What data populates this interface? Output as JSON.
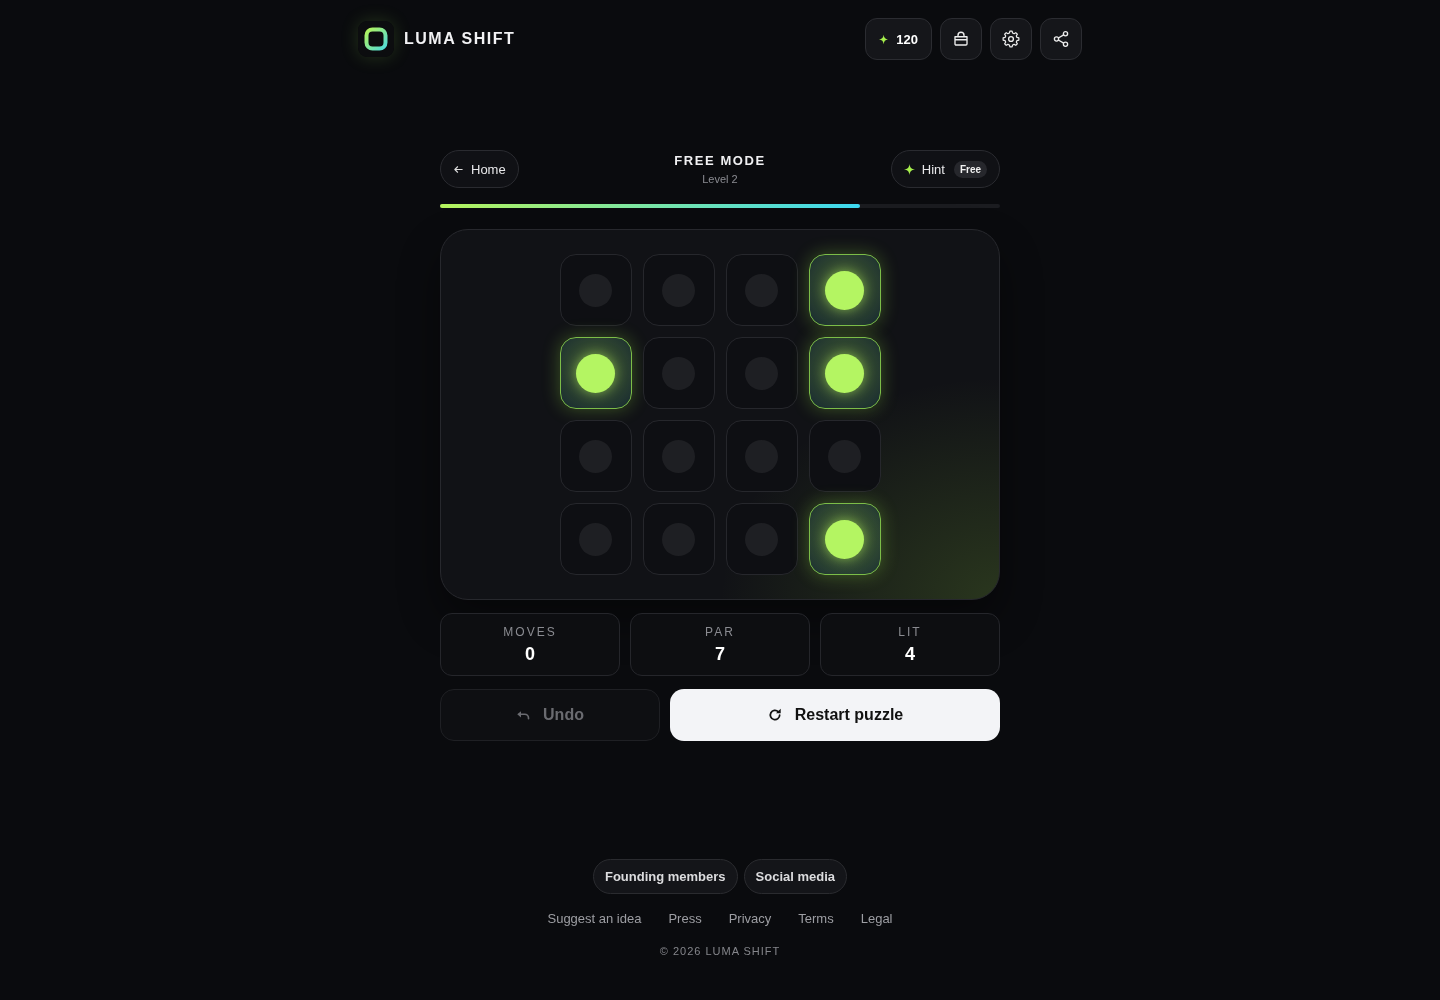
{
  "header": {
    "brand": "LUMA SHIFT",
    "coins": "120"
  },
  "game": {
    "back_button": "Home",
    "mode": "FREE MODE",
    "level": "Level 2",
    "hint": {
      "label": "Hint",
      "badge": "Free"
    },
    "progress": {
      "level": 0.75
    },
    "board": {
      "rows": [
        [
          {
            "lit": false
          },
          {
            "lit": false
          },
          {
            "lit": false
          },
          {
            "lit": true
          }
        ],
        [
          {
            "lit": true
          },
          {
            "lit": false
          },
          {
            "lit": false
          },
          {
            "lit": true
          }
        ],
        [
          {
            "lit": false
          },
          {
            "lit": false
          },
          {
            "lit": false
          },
          {
            "lit": false
          }
        ],
        [
          {
            "lit": false
          },
          {
            "lit": false
          },
          {
            "lit": false
          },
          {
            "lit": true
          }
        ]
      ]
    },
    "stats": [
      {
        "label": "MOVES",
        "value": "0"
      },
      {
        "label": "PAR",
        "value": "7"
      },
      {
        "label": "LIT",
        "value": "4"
      }
    ],
    "undo": {
      "label": "Undo",
      "disabled": true
    },
    "restart": {
      "label": "Restart puzzle"
    }
  },
  "footer": {
    "pills": [
      "Founding members",
      "Social media"
    ],
    "links": [
      "Suggest an idea",
      "Press",
      "Privacy",
      "Terms",
      "Legal"
    ],
    "copyright": "© 2026 LUMA SHIFT"
  }
}
